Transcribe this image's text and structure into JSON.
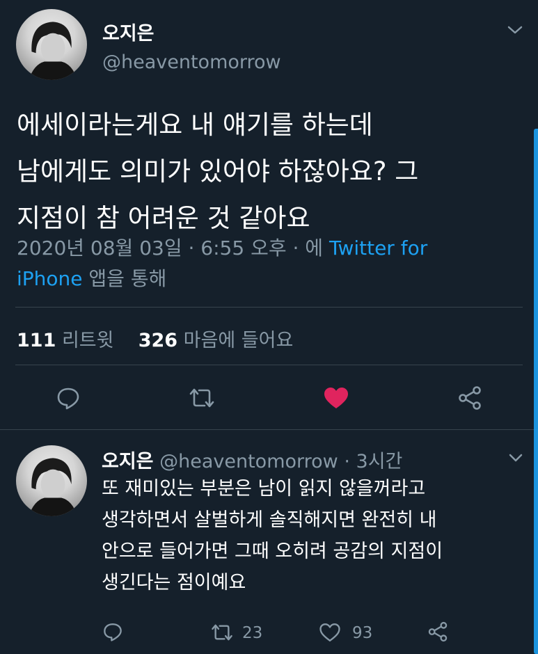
{
  "tweet": {
    "author_name": "오지은",
    "author_handle": "@heaventomorrow",
    "text_lines": [
      "에세이라는게요 내 얘기를 하는데",
      "남에게도 의미가 있어야 하잖아요? 그",
      "지점이 참 어려운 것 같아요"
    ],
    "meta_date": "2020년 08월 03일 · 6:55 오후 · 에 ",
    "meta_app_part1": "Twitter for",
    "meta_app_part2": "iPhone",
    "meta_suffix": " 앱을 통해",
    "retweet_count": "111",
    "retweet_label": "리트윗",
    "like_count": "326",
    "like_label": "마음에 들어요"
  },
  "reply": {
    "author_name": "오지은",
    "author_handle": "@heaventomorrow",
    "time": "· 3시간",
    "text_lines": [
      "또 재미있는 부분은 남이 읽지 않을꺼라고",
      "생각하면서 살벌하게 솔직해지면 완전히 내",
      "안으로 들어가면 그때 오히려 공감의 지점이",
      "생긴다는 점이예요"
    ],
    "retweet_count": "23",
    "like_count": "93"
  },
  "colors": {
    "background": "#15202b",
    "accent": "#1da1f2",
    "like": "#e0245e",
    "muted": "#8899a6",
    "divider": "#38444d"
  },
  "icons": {
    "more": "chevron-down-icon",
    "reply": "comment-icon",
    "retweet": "retweet-icon",
    "like": "heart-icon",
    "share": "share-icon"
  }
}
